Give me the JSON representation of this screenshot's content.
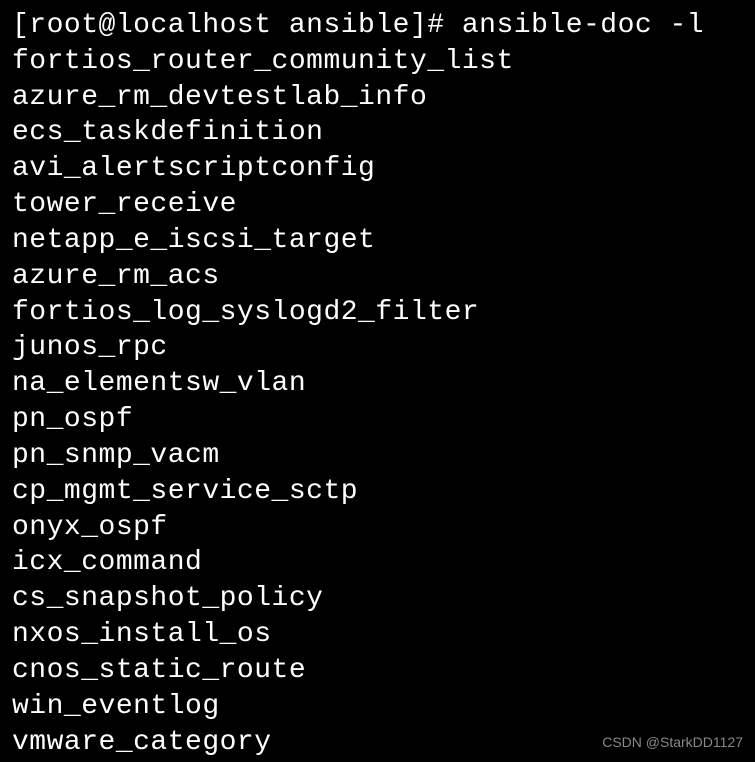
{
  "prompt": {
    "user": "root",
    "host": "localhost",
    "cwd": "ansible",
    "symbol": "#",
    "command": "ansible-doc -l"
  },
  "prompt_line": "[root@localhost ansible]# ansible-doc -l",
  "modules": [
    "fortios_router_community_list",
    "azure_rm_devtestlab_info",
    "ecs_taskdefinition",
    "avi_alertscriptconfig",
    "tower_receive",
    "netapp_e_iscsi_target",
    "azure_rm_acs",
    "fortios_log_syslogd2_filter",
    "junos_rpc",
    "na_elementsw_vlan",
    "pn_ospf",
    "pn_snmp_vacm",
    "cp_mgmt_service_sctp",
    "onyx_ospf",
    "icx_command",
    "cs_snapshot_policy",
    "nxos_install_os",
    "cnos_static_route",
    "win_eventlog",
    "vmware_category"
  ],
  "watermark": "CSDN @StarkDD1127"
}
